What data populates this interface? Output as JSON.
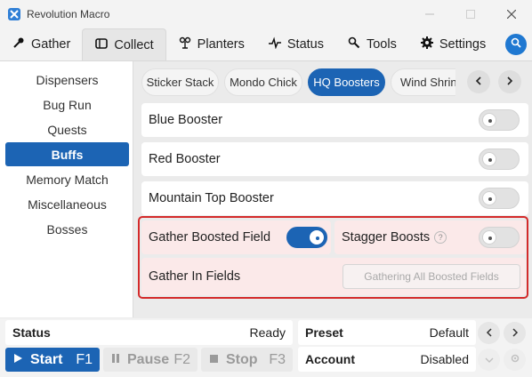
{
  "window": {
    "title": "Revolution Macro"
  },
  "tabs": [
    {
      "label": "Gather",
      "icon": "gather-icon"
    },
    {
      "label": "Collect",
      "icon": "collect-icon",
      "active": true
    },
    {
      "label": "Planters",
      "icon": "planters-icon"
    },
    {
      "label": "Status",
      "icon": "status-pulse-icon"
    },
    {
      "label": "Tools",
      "icon": "tools-icon"
    },
    {
      "label": "Settings",
      "icon": "gear-icon"
    }
  ],
  "sidebar": {
    "items": [
      {
        "label": "Dispensers"
      },
      {
        "label": "Bug Run"
      },
      {
        "label": "Quests"
      },
      {
        "label": "Buffs",
        "active": true
      },
      {
        "label": "Memory Match"
      },
      {
        "label": "Miscellaneous"
      },
      {
        "label": "Bosses"
      }
    ]
  },
  "subtabs": [
    {
      "label": "Sticker Stack"
    },
    {
      "label": "Mondo Chick"
    },
    {
      "label": "HQ Boosters",
      "active": true
    },
    {
      "label": "Wind Shrine"
    }
  ],
  "rows": {
    "blue": {
      "label": "Blue Booster",
      "on": false
    },
    "red": {
      "label": "Red Booster",
      "on": false
    },
    "mountain": {
      "label": "Mountain Top Booster",
      "on": false
    },
    "gather_boosted": {
      "label": "Gather Boosted Field",
      "on": true
    },
    "stagger": {
      "label": "Stagger Boosts",
      "help": "?",
      "on": false
    },
    "gather_in_fields": {
      "label": "Gather In Fields",
      "button": "Gathering All Boosted Fields"
    }
  },
  "bottom": {
    "status_label": "Status",
    "status_value": "Ready",
    "start": {
      "label": "Start",
      "key": "F1"
    },
    "pause": {
      "label": "Pause",
      "key": "F2"
    },
    "stop": {
      "label": "Stop",
      "key": "F3"
    },
    "preset_label": "Preset",
    "preset_value": "Default",
    "account_label": "Account",
    "account_value": "Disabled"
  },
  "colors": {
    "accent": "#1c64b4",
    "highlight_border": "#d42a2a",
    "highlight_bg": "#fbe9e9"
  }
}
